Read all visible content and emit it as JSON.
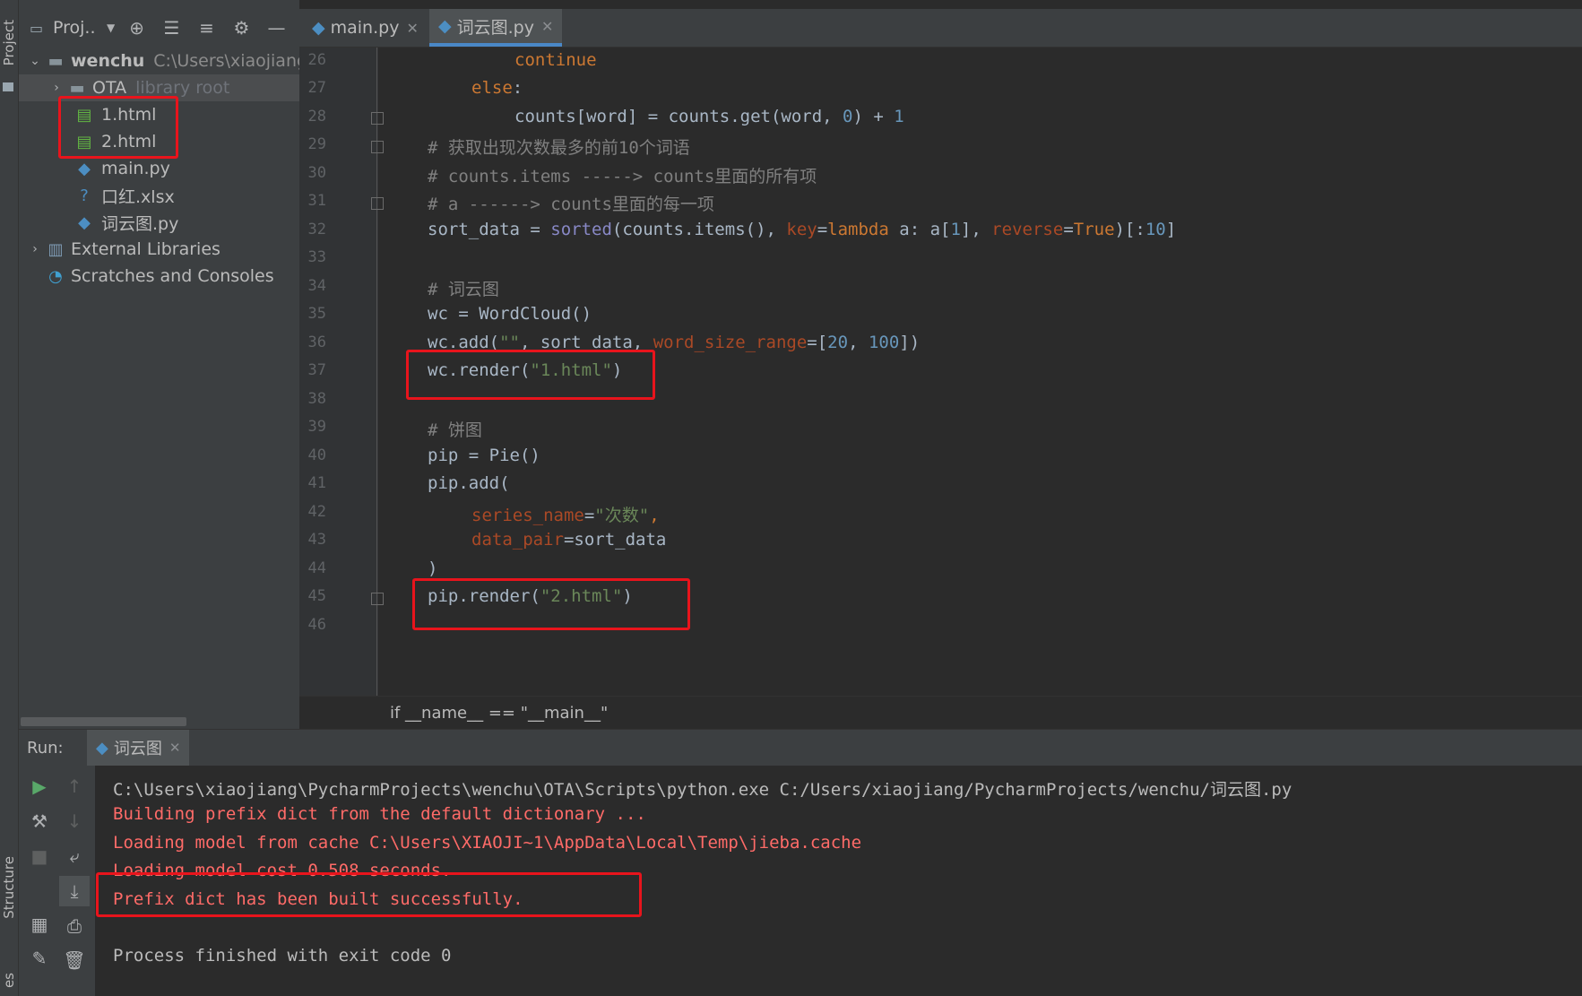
{
  "sidebar_labels": {
    "project": "Project",
    "structure": "Structure",
    "favorites": "es"
  },
  "project_panel": {
    "title": "Proj..",
    "root": {
      "name": "wenchu",
      "path": "C:\\Users\\xiaojiang\\F"
    },
    "items": [
      {
        "name": "OTA",
        "note": "library root"
      },
      {
        "name": "1.html"
      },
      {
        "name": "2.html"
      },
      {
        "name": "main.py"
      },
      {
        "name": "口红.xlsx"
      },
      {
        "name": "词云图.py"
      },
      {
        "name": "External Libraries"
      },
      {
        "name": "Scratches and Consoles"
      }
    ]
  },
  "tabs": [
    {
      "label": "main.py"
    },
    {
      "label": "词云图.py"
    }
  ],
  "editor": {
    "line_numbers": [
      "26",
      "27",
      "28",
      "29",
      "30",
      "31",
      "32",
      "33",
      "34",
      "35",
      "36",
      "37",
      "38",
      "39",
      "40",
      "41",
      "42",
      "43",
      "44",
      "45",
      "46"
    ],
    "lines": {
      "l26": {
        "kw": "continue"
      },
      "l27": {
        "kw": "else",
        "punct": ":"
      },
      "l28": {
        "a": "counts[word] = counts.get(word, ",
        "n1": "0",
        "b": ") + ",
        "n2": "1"
      },
      "l29": {
        "cm": "# 获取出现次数最多的前10个词语"
      },
      "l30": {
        "cm": "# counts.items -----> counts里面的所有项"
      },
      "l31": {
        "cm": "# a ------> counts里面的每一项"
      },
      "l32": {
        "a": "sort_data = ",
        "fn": "sorted",
        "b": "(counts.items(), ",
        "p1": "key",
        "c": "=",
        "kw": "lambda",
        "d": " a: a[",
        "n1": "1",
        "e": "], ",
        "p2": "reverse",
        "f": "=",
        "kw2": "True",
        "g": ")[:",
        "n2": "10",
        "h": "]"
      },
      "l34": {
        "cm": "# 词云图"
      },
      "l35": {
        "a": "wc = WordCloud()"
      },
      "l36": {
        "a": "wc.add(",
        "s": "\"\"",
        "b": ", sort_data, ",
        "p": "word_size_range",
        "c": "=[",
        "n1": "20",
        "d": ", ",
        "n2": "100",
        "e": "])"
      },
      "l37": {
        "a": "wc.render(",
        "s": "\"1.html\"",
        "b": ")"
      },
      "l39": {
        "cm": "# 饼图"
      },
      "l40": {
        "a": "pip = Pie()"
      },
      "l41": {
        "a": "pip.add("
      },
      "l42": {
        "p": "series_name",
        "a": "=",
        "s": "\"次数\"",
        "b": ","
      },
      "l43": {
        "p": "data_pair",
        "a": "=sort_data"
      },
      "l44": {
        "a": ")"
      },
      "l45": {
        "a": "pip.render(",
        "s": "\"2.html\"",
        "b": ")"
      }
    }
  },
  "breadcrumb": "if __name__ == \"__main__\"",
  "run": {
    "label": "Run:",
    "tab": "词云图",
    "console_lines": [
      {
        "text": "C:\\Users\\xiaojiang\\PycharmProjects\\wenchu\\OTA\\Scripts\\python.exe C:/Users/xiaojiang/PycharmProjects/wenchu/词云图.py",
        "kind": "normal"
      },
      {
        "text": "Building prefix dict from the default dictionary ...",
        "kind": "err"
      },
      {
        "text": "Loading model from cache C:\\Users\\XIAOJI~1\\AppData\\Local\\Temp\\jieba.cache",
        "kind": "err"
      },
      {
        "text": "Loading model cost 0.508 seconds.",
        "kind": "err"
      },
      {
        "text": "Prefix dict has been built successfully.",
        "kind": "err"
      },
      {
        "text": "",
        "kind": "normal"
      },
      {
        "text": "Process finished with exit code 0",
        "kind": "normal"
      }
    ]
  },
  "colors": {
    "highlight_box": "#e8141c",
    "accent": "#4a88c7",
    "error_text": "#ff6b68"
  }
}
